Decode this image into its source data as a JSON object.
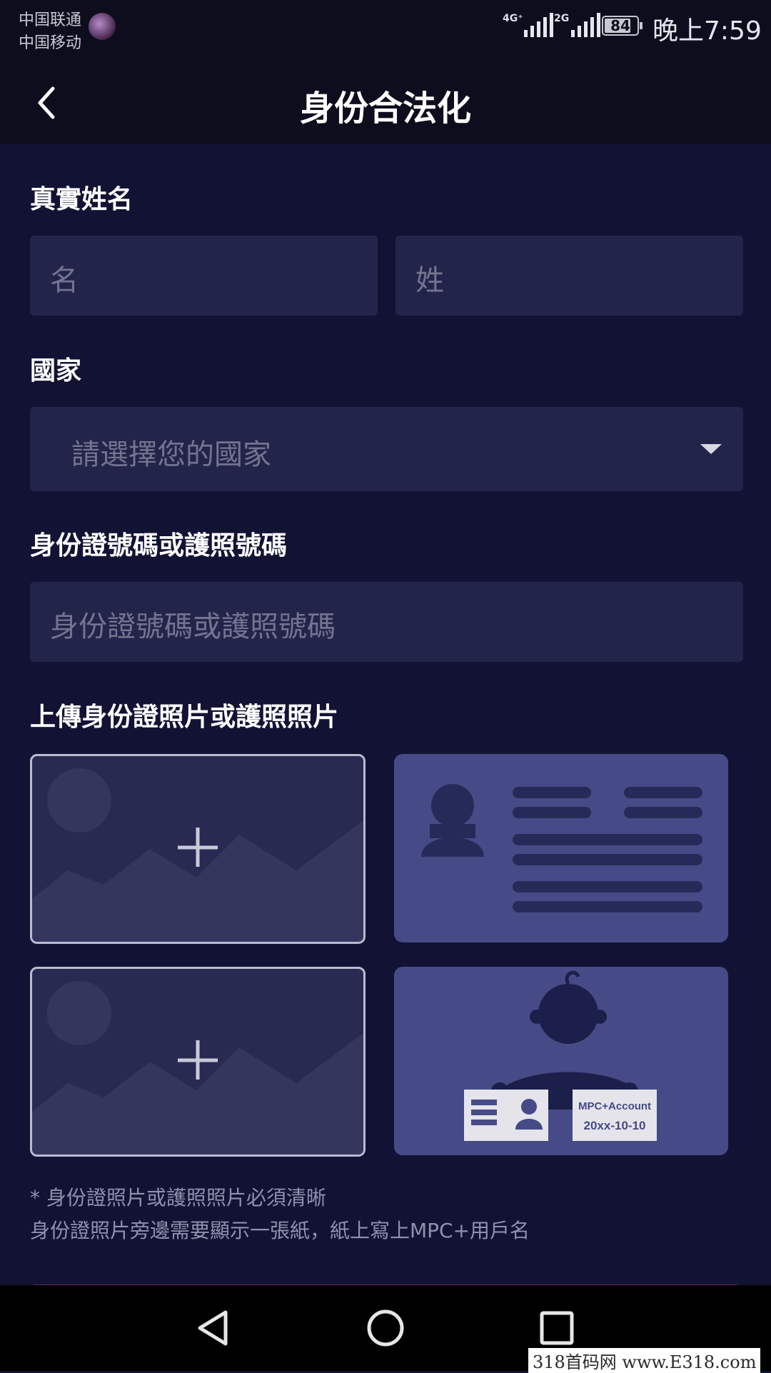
{
  "status_bar": {
    "carrier_1": "中国联通",
    "carrier_2": "中国移动",
    "network_1": "4G⁺",
    "network_2": "2G",
    "battery": "84",
    "time": "晚上7:59"
  },
  "header": {
    "title": "身份合法化",
    "back_icon": "chevron-left-icon"
  },
  "form": {
    "name_label": "真實姓名",
    "first_name_placeholder": "名",
    "last_name_placeholder": "姓",
    "country_label": "國家",
    "country_placeholder": "請選擇您的國家",
    "id_label": "身份證號碼或護照號碼",
    "id_placeholder": "身份證號碼或護照號碼",
    "upload_label": "上傳身份證照片或護照照片",
    "sample_card_text_1": "MPC+Account",
    "sample_card_text_2": "20xx-10-10",
    "note_1": "* 身份證照片或護照照片必須清晰",
    "note_2": "身份證照片旁邊需要顯示一張紙，紙上寫上MPC+用戶名"
  },
  "nav_bar": {
    "back_icon": "triangle-back-icon",
    "home_icon": "circle-home-icon",
    "recents_icon": "square-recents-icon"
  },
  "watermark": "318首码网 www.E318.com",
  "colors": {
    "background": "#121334",
    "header": "#0d0d1e",
    "field": "#23244a",
    "sample_card": "#464a86"
  }
}
